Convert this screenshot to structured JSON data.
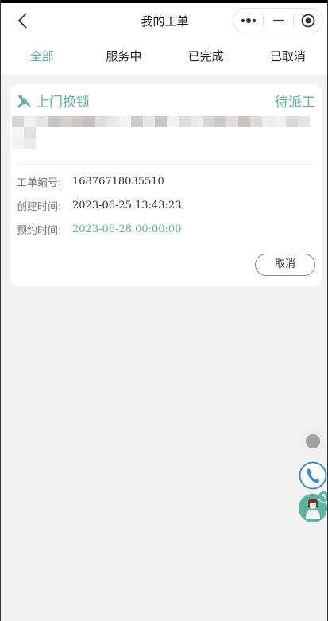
{
  "navbar": {
    "title": "我的工单"
  },
  "tabs": [
    {
      "label": "全部",
      "active": true
    },
    {
      "label": "服务中",
      "active": false
    },
    {
      "label": "已完成",
      "active": false
    },
    {
      "label": "已取消",
      "active": false
    }
  ],
  "order": {
    "service_type": "上门换锁",
    "status": "待派工",
    "fields": [
      {
        "label": "工单编号:",
        "value": "16876718035510",
        "highlight": false
      },
      {
        "label": "创建时间:",
        "value": "2023-06-25 13:43:23",
        "highlight": false
      },
      {
        "label": "预约时间:",
        "value": "2023-06-28 00:00:00",
        "highlight": true
      }
    ],
    "cancel_label": "取消"
  },
  "floating": {
    "badge_count": "5"
  },
  "colors": {
    "accent": "#5bb3a0",
    "background": "#f2f2f2"
  },
  "icons": {
    "back": "chevron-left-icon",
    "more": "more-dots-icon",
    "minimize": "minus-icon",
    "close": "target-circle-icon",
    "wrench": "wrench-icon",
    "record": "record-dot-icon",
    "phone": "phone-icon",
    "service": "customer-service-avatar-icon"
  }
}
